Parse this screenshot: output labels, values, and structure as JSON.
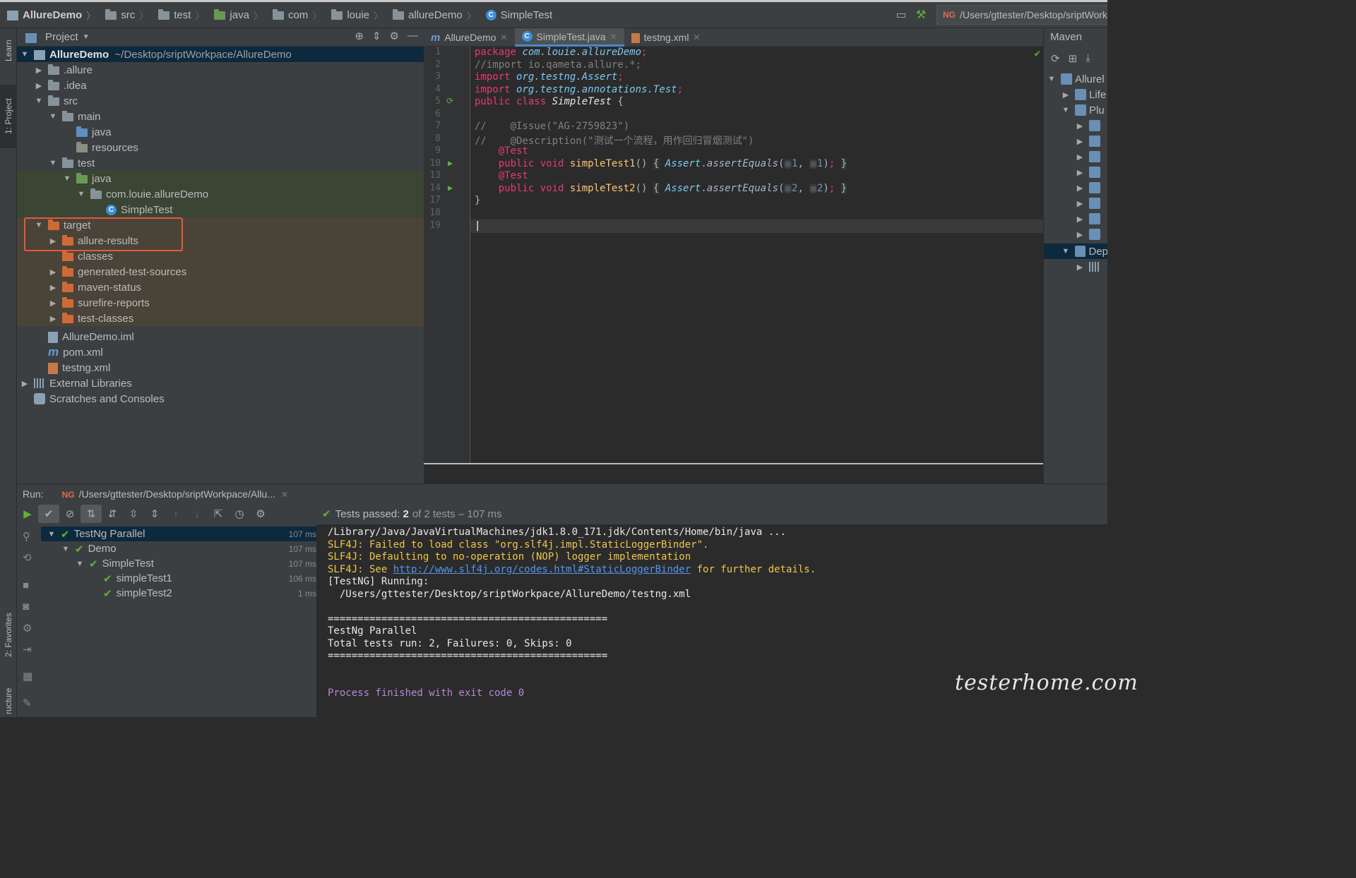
{
  "breadcrumbs": [
    "AllureDemo",
    "src",
    "test",
    "java",
    "com",
    "louie",
    "allureDemo",
    "SimpleTest"
  ],
  "run_config": "/Users/gttester/Desktop/sriptWorkpace/Allu",
  "side_tabs": {
    "learn": "Learn",
    "project": "1: Project",
    "favorites": "2: Favorites",
    "structure": "ructure"
  },
  "project_panel": {
    "title": "Project",
    "tree": [
      {
        "label": "AllureDemo",
        "extra": "~/Desktop/sriptWorkpace/AllureDemo"
      },
      {
        "label": ".allure"
      },
      {
        "label": ".idea"
      },
      {
        "label": "src"
      },
      {
        "label": "main"
      },
      {
        "label": "java"
      },
      {
        "label": "resources"
      },
      {
        "label": "test"
      },
      {
        "label": "java"
      },
      {
        "label": "com.louie.allureDemo"
      },
      {
        "label": "SimpleTest"
      },
      {
        "label": "target"
      },
      {
        "label": "allure-results"
      },
      {
        "label": "classes"
      },
      {
        "label": "generated-test-sources"
      },
      {
        "label": "maven-status"
      },
      {
        "label": "surefire-reports"
      },
      {
        "label": "test-classes"
      },
      {
        "label": "AllureDemo.iml"
      },
      {
        "label": "pom.xml"
      },
      {
        "label": "testng.xml"
      },
      {
        "label": "External Libraries"
      },
      {
        "label": "Scratches and Consoles"
      }
    ]
  },
  "editor": {
    "tabs": [
      "AllureDemo",
      "SimpleTest.java",
      "testng.xml"
    ],
    "line_numbers": [
      "1",
      "2",
      "3",
      "4",
      "5",
      "6",
      "7",
      "8",
      "9",
      "10",
      "13",
      "14",
      "17",
      "18",
      "19"
    ]
  },
  "maven_panel": {
    "title": "Maven",
    "items": [
      "Allurel",
      "Life",
      "Plu",
      "Dep"
    ]
  },
  "run_panel": {
    "label": "Run:",
    "config": "/Users/gttester/Desktop/sriptWorkpace/Allu...",
    "status_prefix": "Tests passed:",
    "status_count": "2",
    "status_rest": "of 2 tests – 107 ms",
    "tests": [
      {
        "label": "TestNg Parallel",
        "time": "107 ms"
      },
      {
        "label": "Demo",
        "time": "107 ms"
      },
      {
        "label": "SimpleTest",
        "time": "107 ms"
      },
      {
        "label": "simpleTest1",
        "time": "106 ms"
      },
      {
        "label": "simpleTest2",
        "time": "1 ms"
      }
    ],
    "console": {
      "line1": "/Library/Java/JavaVirtualMachines/jdk1.8.0_171.jdk/Contents/Home/bin/java ...",
      "line2": "SLF4J: Failed to load class \"org.slf4j.impl.StaticLoggerBinder\".",
      "line3": "SLF4J: Defaulting to no-operation (NOP) logger implementation",
      "line4_pre": "SLF4J: See ",
      "line4_link": "http://www.slf4j.org/codes.html#StaticLoggerBinder",
      "line4_post": " for further details.",
      "line5": "[TestNG] Running:",
      "line6": "  /Users/gttester/Desktop/sriptWorkpace/AllureDemo/testng.xml",
      "sep": "===============================================",
      "line7": "TestNg Parallel",
      "line8": "Total tests run: 2, Failures: 0, Skips: 0",
      "line9": "Process finished with exit code 0"
    }
  },
  "watermark": "testerhome.com",
  "colors": {
    "accent_highlight": "#e15b3b",
    "pass_green": "#5fb336",
    "keyword": "#e8377b",
    "link": "#5394ec"
  }
}
